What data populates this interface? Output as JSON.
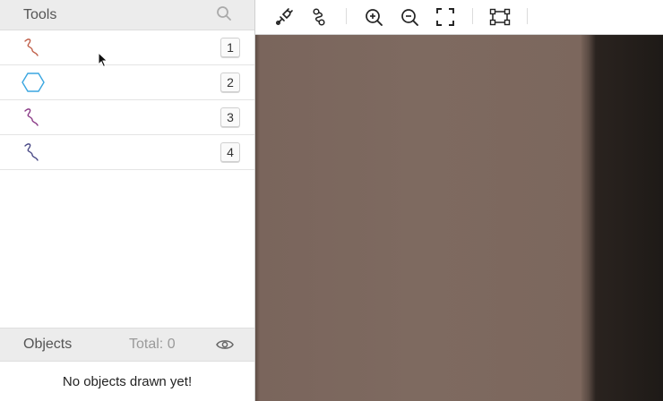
{
  "sidebar": {
    "tools_title": "Tools",
    "tools": [
      {
        "key": "1",
        "icon": "squiggle-icon",
        "color": "#c0604a"
      },
      {
        "key": "2",
        "icon": "hexagon-icon",
        "color": "#3aa6e0"
      },
      {
        "key": "3",
        "icon": "squiggle-icon",
        "color": "#8a3a86"
      },
      {
        "key": "4",
        "icon": "squiggle-icon",
        "color": "#4a4a86"
      }
    ],
    "objects_title": "Objects",
    "objects_total": "Total: 0",
    "empty_message": "No objects drawn yet!"
  },
  "toolbar": {
    "buttons": [
      "point-tool-icon",
      "link-tool-icon",
      "zoom-in-icon",
      "zoom-out-icon",
      "fullscreen-icon",
      "bounding-box-icon"
    ]
  }
}
